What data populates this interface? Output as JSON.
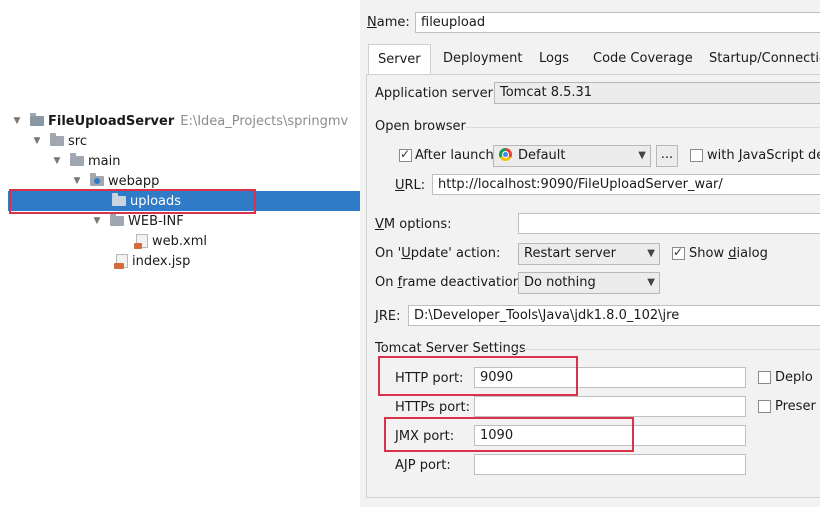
{
  "tree": {
    "items": [
      {
        "label": "FileUploadServer",
        "path": "E:\\Idea_Projects\\springmv"
      },
      {
        "label": "src"
      },
      {
        "label": "main"
      },
      {
        "label": "webapp"
      },
      {
        "label": "uploads"
      },
      {
        "label": "WEB-INF"
      },
      {
        "label": "web.xml"
      },
      {
        "label": "index.jsp"
      }
    ]
  },
  "config": {
    "name_label": "Name:",
    "name_value": "fileupload",
    "tabs": [
      "Server",
      "Deployment",
      "Logs",
      "Code Coverage",
      "Startup/Connectio"
    ],
    "app_server_label": "Application server:",
    "app_server_value": "Tomcat 8.5.31",
    "open_browser_label": "Open browser",
    "after_launch_label": "After launch",
    "browser_value": "Default",
    "ellipsis": "...",
    "with_js_label": "with JavaScript de",
    "url_label": "URL:",
    "url_value": "http://localhost:9090/FileUploadServer_war/",
    "vm_options_label": "VM options:",
    "on_update_label": "On 'Update' action:",
    "on_update_value": "Restart server",
    "show_dialog_label": "Show dialog",
    "on_frame_label": "On frame deactivation:",
    "on_frame_value": "Do nothing",
    "jre_label": "JRE:",
    "jre_value": "D:\\Developer_Tools\\Java\\jdk1.8.0_102\\jre",
    "tomcat_settings_label": "Tomcat Server Settings",
    "http_port_label": "HTTP port:",
    "http_port_value": "9090",
    "https_port_label": "HTTPs port:",
    "https_port_value": "",
    "jmx_port_label": "JMX port:",
    "jmx_port_value": "1090",
    "ajp_port_label": "AJP port:",
    "ajp_port_value": "",
    "deploy_label": "Deplo",
    "preserve_label": "Preser"
  }
}
